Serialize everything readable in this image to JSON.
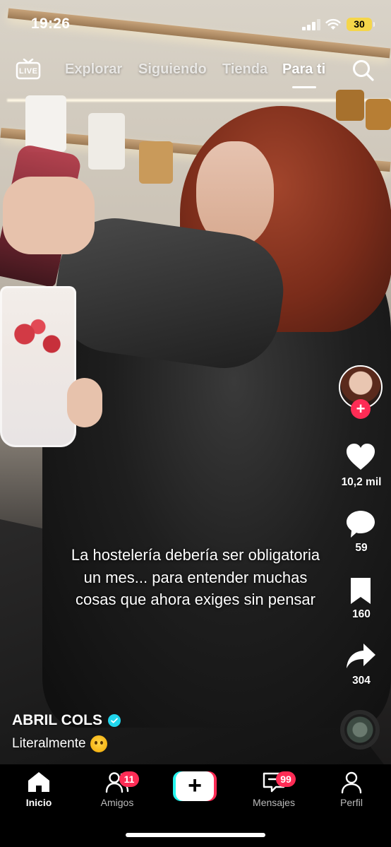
{
  "status_bar": {
    "time": "19:26",
    "battery": "30"
  },
  "top_nav": {
    "live_label": "LIVE",
    "tabs": [
      {
        "label": "Explorar",
        "active": false
      },
      {
        "label": "Siguiendo",
        "active": false
      },
      {
        "label": "Tienda",
        "active": false
      },
      {
        "label": "Para ti",
        "active": true
      }
    ]
  },
  "right_rail": {
    "likes": "10,2 mil",
    "comments": "59",
    "saves": "160",
    "shares": "304"
  },
  "video": {
    "overlay_text": "La hostelería debería ser obligatoria un mes... para entender muchas cosas que ahora exiges sin pensar"
  },
  "author": {
    "username": "ABRIL COLS",
    "verified": true
  },
  "caption": {
    "text": "Literalmente",
    "emoji": "shushing-face"
  },
  "tab_bar": {
    "items": [
      {
        "label": "Inicio",
        "active": true
      },
      {
        "label": "Amigos",
        "badge": "11"
      },
      {
        "label": ""
      },
      {
        "label": "Mensajes",
        "badge": "99"
      },
      {
        "label": "Perfil"
      }
    ]
  },
  "colors": {
    "accent": "#fe2c55",
    "cyan": "#25f4ee",
    "verified": "#20d5ec",
    "battery": "#f5d64a"
  }
}
